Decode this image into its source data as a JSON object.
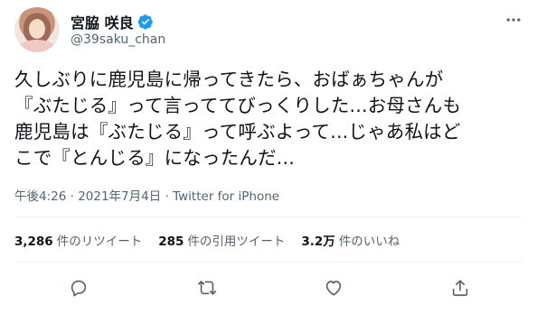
{
  "author": {
    "display_name": "宮脇 咲良",
    "handle": "@39saku_chan",
    "verified": true
  },
  "tweet": {
    "lines": [
      "久しぶりに鹿児島に帰ってきたら、おばぁちゃんが",
      "『ぶたじる』って言っててびっくりした...お母さんも",
      "鹿児島は『ぶたじる』って呼ぶよって...じゃあ私はど",
      "こで『とんじる』になったんだ..."
    ]
  },
  "meta": {
    "time": "午後4:26",
    "separator1": " · ",
    "date": "2021年7月4日",
    "separator2": " · ",
    "source": "Twitter for iPhone"
  },
  "stats": {
    "retweets": {
      "count": "3,286",
      "label": "件のリツイート"
    },
    "quotes": {
      "count": "285",
      "label": "件の引用ツイート"
    },
    "likes": {
      "count": "3.2万",
      "label": "件のいいね"
    }
  },
  "icons": {
    "verified": "verified-badge-icon",
    "more": "more-options-icon",
    "reply": "reply-icon",
    "retweet": "retweet-icon",
    "like": "heart-icon",
    "share": "share-icon"
  },
  "colors": {
    "text": "#0f1419",
    "secondary": "#536471",
    "verified": "#1d9bf0",
    "divider": "#eff3f4"
  }
}
